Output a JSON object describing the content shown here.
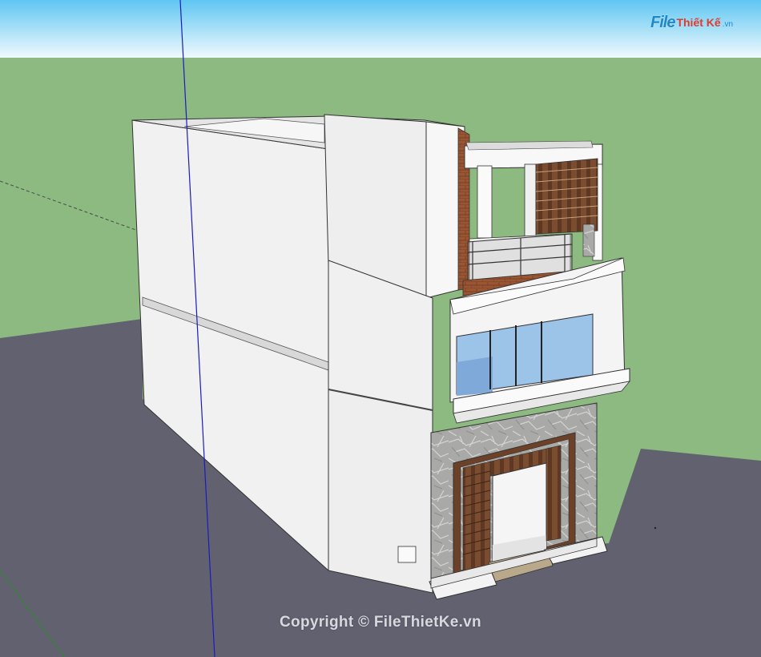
{
  "colors": {
    "sky_top": "#5fc6f2",
    "sky_bottom": "#f4fbfe",
    "ground": "#8cba80",
    "road": "#62616f",
    "wall": "#f1f1f1",
    "wall_shade": "#e1e1e1",
    "brick": "#9a5533",
    "wood": "#7a4c30",
    "glass": "#9cc3e8",
    "stone": "#a9aaa8",
    "axis_blue": "#1b1bbf"
  },
  "logo": {
    "prefix": "File",
    "name": "Thiết Kế",
    "suffix": ".vn"
  },
  "watermark": {
    "text": "Copyright © FileThietKe.vn"
  }
}
